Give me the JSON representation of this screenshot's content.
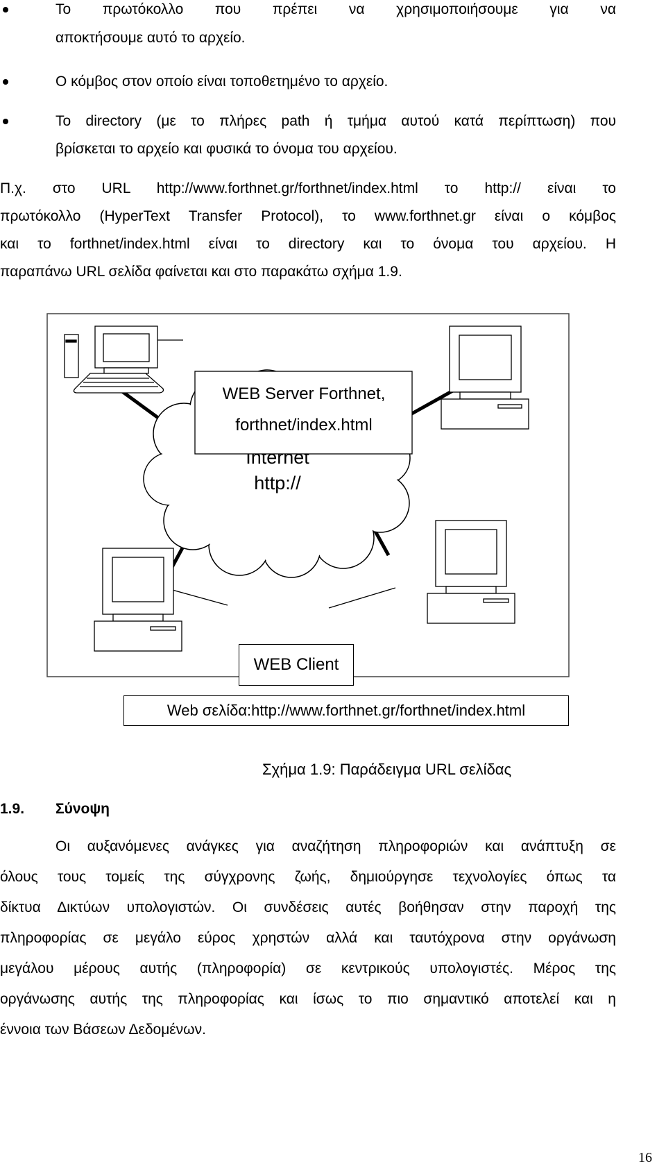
{
  "bullets": [
    {
      "lines": [
        "Το πρωτόκολλο που πρέπει να χρησιμοποιήσουμε για να",
        "αποκτήσουμε αυτό το αρχείο."
      ]
    },
    {
      "lines": [
        "Ο κόμβος στον οποίο είναι τοποθετημένο το αρχείο."
      ]
    },
    {
      "lines": [
        "Το directory (με το πλήρες path ή τμήμα αυτού κατά περίπτωση) που",
        "βρίσκεται το αρχείο και φυσικά το όνομα του αρχείου."
      ]
    }
  ],
  "example_paragraph": [
    "Π.χ. στο URL http://www.forthnet.gr/forthnet/index.html το http:// είναι το",
    "πρωτόκολλο (HyperText Transfer Protocol), το www.forthnet.gr είναι ο κόμβος",
    "και το forthnet/index.html είναι το directory και το όνομα του αρχείου. Η",
    "παραπάνω URL σελίδα φαίνεται και στο παρακάτω σχήμα 1.9."
  ],
  "figure": {
    "server_label": [
      "WEB Server Forthnet,",
      "forthnet/index.html"
    ],
    "cloud_label": [
      "Internet",
      "http://"
    ],
    "client_label": "WEB Client",
    "page_label": "Web σελίδα:http://www.forthnet.gr/forthnet/index.html",
    "caption": "Σχήμα 1.9: Παράδειγμα URL σελίδας"
  },
  "section": {
    "number": "1.9.",
    "title": "Σύνοψη",
    "lines": [
      "Οι αυξανόμενες ανάγκες για αναζήτηση πληροφοριών και ανάπτυξη σε",
      "όλους τους τομείς της σύγχρονης ζωής, δημιούργησε τεχνολογίες όπως τα",
      "δίκτυα Δικτύων υπολογιστών. Οι συνδέσεις αυτές βοήθησαν στην παροχή της",
      "πληροφορίας σε μεγάλο εύρος χρηστών αλλά και ταυτόχρονα στην οργάνωση",
      "μεγάλου μέρους αυτής (πληροφορία) σε κεντρικούς υπολογιστές. Μέρος της",
      "οργάνωσης αυτής της πληροφορίας και ίσως το πιο σημαντικό αποτελεί και η",
      "έννοια των Βάσεων Δεδομένων."
    ]
  },
  "page_number": "16"
}
